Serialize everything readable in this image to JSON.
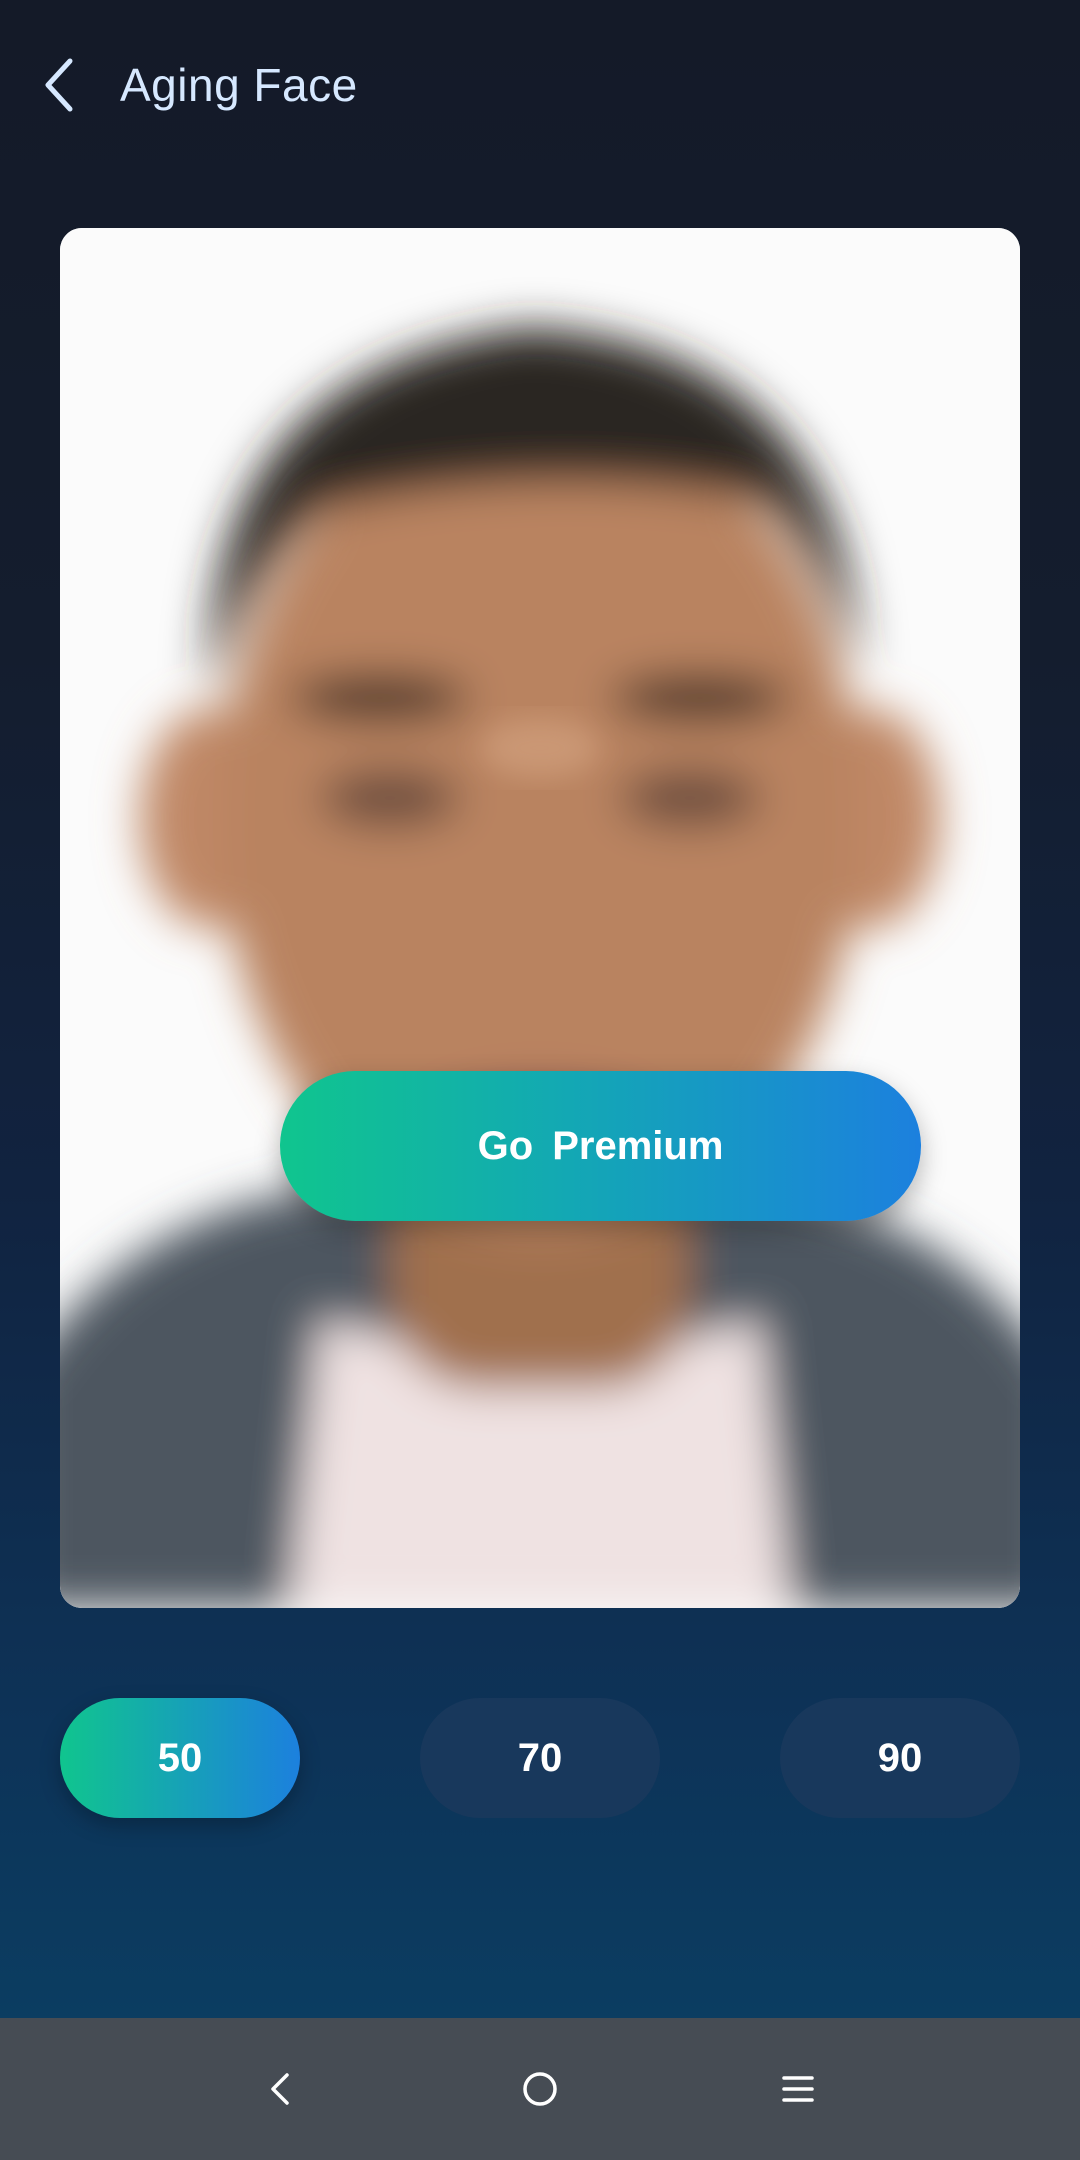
{
  "header": {
    "title": "Aging Face",
    "back_icon": "chevron-left-icon"
  },
  "photo": {
    "premium_label": "Go  Premium",
    "accent_gradient": [
      "#10c58e",
      "#1c80de"
    ]
  },
  "age_options": {
    "items": [
      {
        "label": "50",
        "selected": true
      },
      {
        "label": "70",
        "selected": false
      },
      {
        "label": "90",
        "selected": false
      }
    ]
  },
  "nav_bar": {
    "back_icon": "nav-back-icon",
    "home_icon": "nav-home-icon",
    "menu_icon": "nav-menu-icon"
  },
  "colors": {
    "background_top": "#141a28",
    "background_bottom": "#0a4266",
    "title_color": "#d6e8ff",
    "unselected_pill": "#18385c",
    "nav_bar": "#464c54"
  }
}
